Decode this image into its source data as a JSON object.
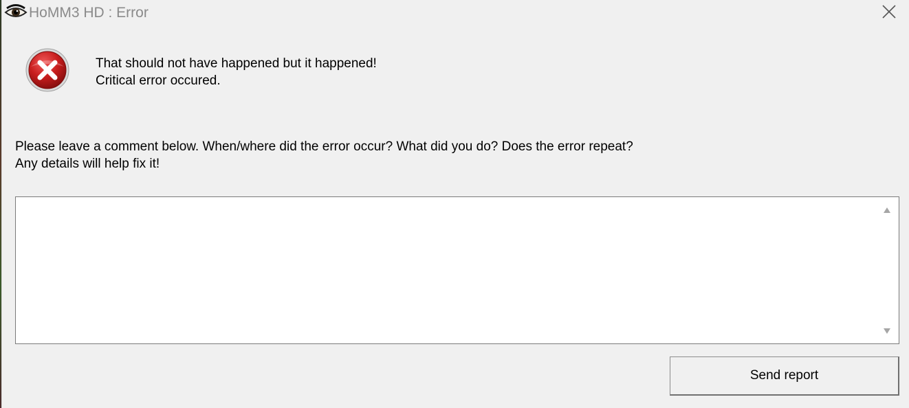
{
  "window": {
    "title": "HoMM3 HD : Error",
    "close_icon": "close-icon",
    "app_icon": "eye-icon"
  },
  "error": {
    "icon": "error-icon",
    "icon_color": "#c81e1e",
    "message_line1": "That should not have happened but it happened!",
    "message_line2": "Critical error occured."
  },
  "instructions": {
    "line1": "Please leave a comment below. When/where did the error occur? What did you do? Does the error repeat?",
    "line2": "Any details will help fix it!"
  },
  "comment": {
    "value": "",
    "placeholder": ""
  },
  "actions": {
    "send_label": "Send report"
  }
}
